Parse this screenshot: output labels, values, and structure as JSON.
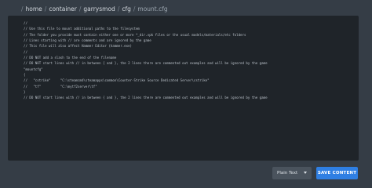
{
  "breadcrumb": {
    "items": [
      "home",
      "container",
      "garrysmod",
      "cfg"
    ],
    "current": "mount.cfg",
    "separator": "/"
  },
  "editor": {
    "lines": [
      "",
      "//",
      "// Use this file to mount additional paths to the filesystem",
      "// The folder you provide must contain either one or more *_dir.vpk files or the usual models/materials/etc folders",
      "// Lines starting with // are comments and are ignored by the game",
      "// This file will also affect Hammer Editor (hammer.exe)",
      "//",
      "",
      "// DO NOT add a slash to the end of the filename",
      "// DO NOT start lines with // in between { and }, the 2 lines there are commented out examples and will be ignored by the game",
      "",
      "\"mountcfg\"",
      "{",
      "//   \"cstrike\"     \"C:\\steamcmd\\steamapps\\common\\Counter-Strike Source Dedicated Server\\cstrike\"",
      "//   \"tf\"          \"C:\\mytf2server\\tf\"",
      "}",
      "",
      "// DO NOT start lines with // in between { and }, the 2 lines there are commented out examples and will be ignored by the game",
      "",
      "",
      "",
      "",
      "",
      "",
      ""
    ]
  },
  "footer": {
    "mode_select": "Plain Text",
    "save_label": "SAVE CONTENT"
  },
  "colors": {
    "background": "#353d46",
    "editor_background": "#1f2429",
    "save_button": "#2f7fe3",
    "select_background": "#4a535d"
  }
}
